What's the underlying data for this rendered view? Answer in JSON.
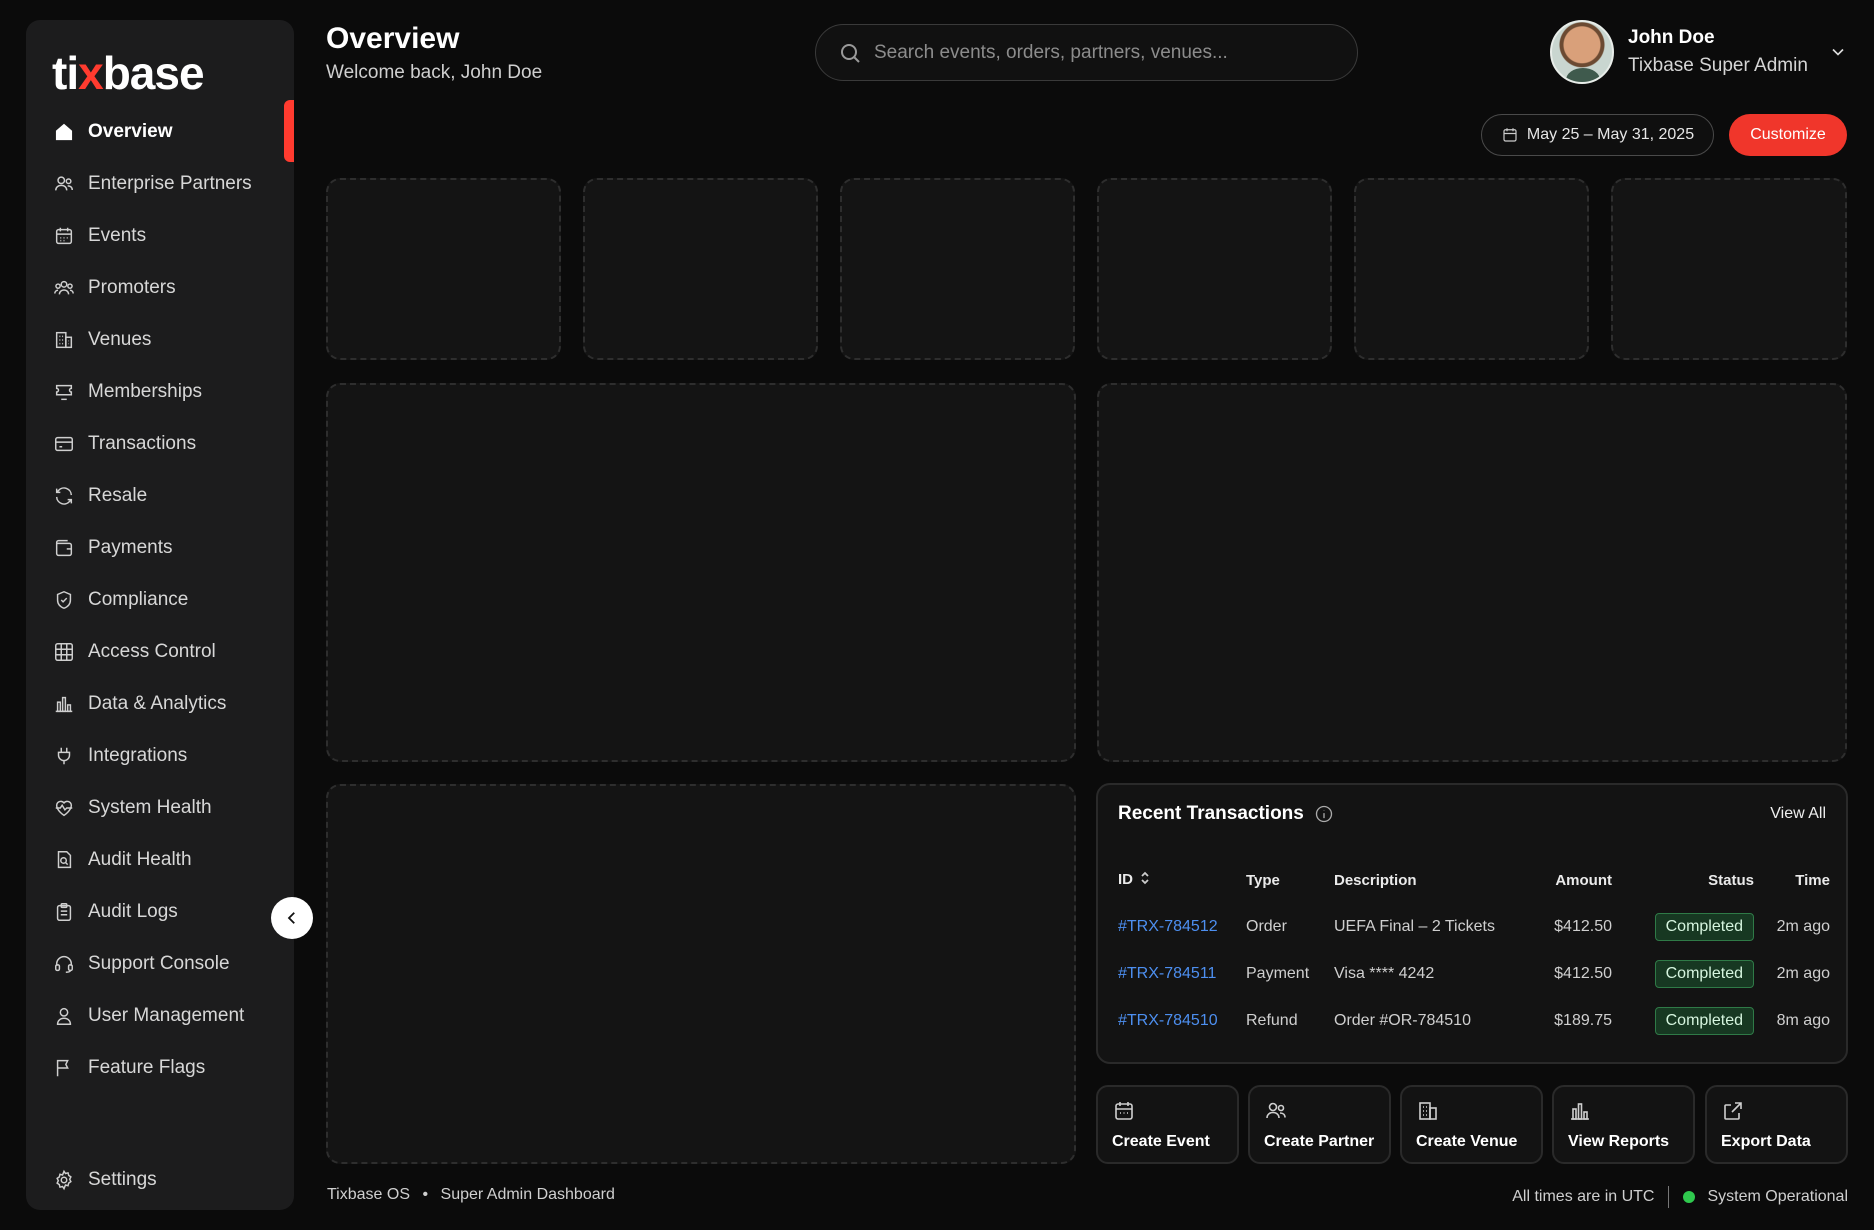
{
  "brand": {
    "logo_part1": "ti",
    "logo_x": "x",
    "logo_part2": "base"
  },
  "header": {
    "title": "Overview",
    "subtitle": "Welcome back, John Doe",
    "search_placeholder": "Search events, orders, partners, venues...",
    "user_name": "John Doe",
    "user_role": "Tixbase Super Admin",
    "date_range": "May 25 – May 31, 2025",
    "customize": "Customize"
  },
  "sidebar": {
    "items": [
      {
        "label": "Overview",
        "icon": "home-icon"
      },
      {
        "label": "Enterprise Partners",
        "icon": "partners-icon"
      },
      {
        "label": "Events",
        "icon": "calendar-icon"
      },
      {
        "label": "Promoters",
        "icon": "users-icon"
      },
      {
        "label": "Venues",
        "icon": "building-icon"
      },
      {
        "label": "Memberships",
        "icon": "ticket-icon"
      },
      {
        "label": "Transactions",
        "icon": "card-icon"
      },
      {
        "label": "Resale",
        "icon": "refresh-icon"
      },
      {
        "label": "Payments",
        "icon": "wallet-icon"
      },
      {
        "label": "Compliance",
        "icon": "shield-check-icon"
      },
      {
        "label": "Access Control",
        "icon": "grid-lock-icon"
      },
      {
        "label": "Data & Analytics",
        "icon": "bar-chart-icon"
      },
      {
        "label": "Integrations",
        "icon": "plug-icon"
      },
      {
        "label": "System Health",
        "icon": "heart-pulse-icon"
      },
      {
        "label": "Audit Health",
        "icon": "search-doc-icon"
      },
      {
        "label": "Audit Logs",
        "icon": "clipboard-icon"
      },
      {
        "label": "Support Console",
        "icon": "headset-icon"
      },
      {
        "label": "User Management",
        "icon": "user-icon"
      },
      {
        "label": "Feature Flags",
        "icon": "flag-icon"
      }
    ],
    "settings": "Settings"
  },
  "transactions": {
    "title": "Recent Transactions",
    "view_all": "View All",
    "columns": [
      "ID",
      "Type",
      "Description",
      "Amount",
      "Status",
      "Time"
    ],
    "rows": [
      {
        "id": "#TRX-784512",
        "type": "Order",
        "description": "UEFA Final – 2 Tickets",
        "amount": "$412.50",
        "status": "Completed",
        "time": "2m ago"
      },
      {
        "id": "#TRX-784511",
        "type": "Payment",
        "description": "Visa **** 4242",
        "amount": "$412.50",
        "status": "Completed",
        "time": "2m ago"
      },
      {
        "id": "#TRX-784510",
        "type": "Refund",
        "description": "Order #OR-784510",
        "amount": "$189.75",
        "status": "Completed",
        "time": "8m ago"
      }
    ]
  },
  "quick_actions": [
    {
      "label": "Create Event",
      "icon": "calendar-icon"
    },
    {
      "label": "Create Partner",
      "icon": "partners-icon"
    },
    {
      "label": "Create Venue",
      "icon": "building-icon"
    },
    {
      "label": "View Reports",
      "icon": "bar-chart-icon"
    },
    {
      "label": "Export Data",
      "icon": "external-link-icon"
    }
  ],
  "footer": {
    "app": "Tixbase OS",
    "separator": "•",
    "context": "Super Admin Dashboard",
    "timezone": "All times are in UTC",
    "status": "System Operational"
  },
  "colors": {
    "accent": "#f0362b",
    "link": "#4d8ff0",
    "success": "#4cc463",
    "warning": "#ef9a3a"
  }
}
